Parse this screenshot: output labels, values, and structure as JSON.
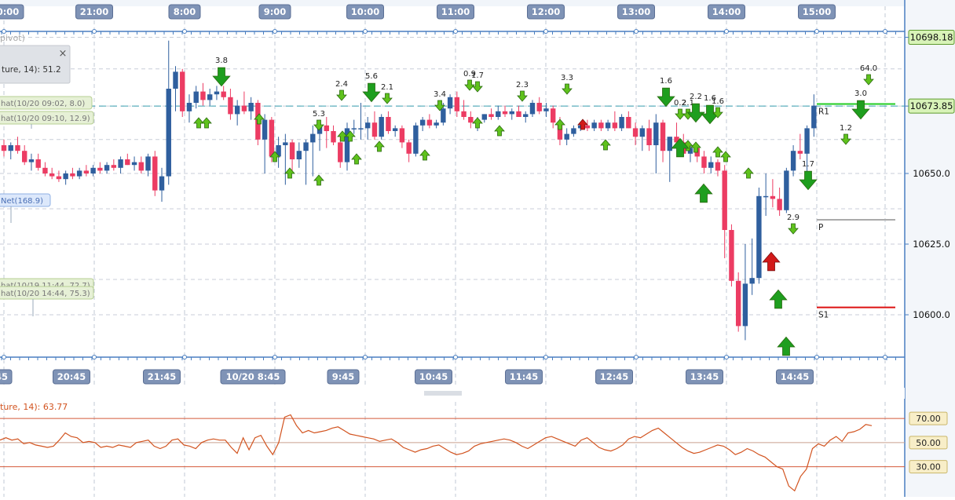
{
  "chart_data": {
    "type": "candlestick",
    "time_axis_top": [
      "0:00",
      "21:00",
      "8:00",
      "9:00",
      "10:00",
      "11:00",
      "12:00",
      "13:00",
      "14:00",
      "15:00"
    ],
    "time_axis_bottom": [
      "45",
      "20:45",
      "21:45",
      "10/20 8:45",
      "9:45",
      "10:45",
      "11:45",
      "12:45",
      "13:45",
      "14:45"
    ],
    "price_axis_labels": [
      "10698.18",
      "10673.85",
      "10650.0",
      "10625.0",
      "10600.0"
    ],
    "ylim": [
      10585,
      10705
    ],
    "current_price_top": 10698.18,
    "current_price": 10673.85,
    "pivot_lines": [
      {
        "label": "R1",
        "value": 10674.6,
        "color": "#22cc22"
      },
      {
        "label": "P",
        "value": 10633.6,
        "color": "#aaaaaa"
      },
      {
        "label": "S1",
        "value": 10602.6,
        "color": "#dd1111"
      }
    ],
    "legend_header": "pivot)",
    "indicator_panel": {
      "text": "ture, 14): 51.2",
      "close_symbol": "×"
    },
    "line_notes": [
      {
        "text": "hat(10/20 09:02, 8.0)"
      },
      {
        "text": "hat(10/20 09:10, 12.9)"
      },
      {
        "text": "Net(168.9)"
      },
      {
        "text": "hat(10/19 11:44, 72.7)"
      },
      {
        "text": "hat(10/20 14:44, 75.3)"
      }
    ],
    "arrow_values": [
      "3.8",
      "5.3",
      "2.4",
      "5.6",
      "2.1",
      "3.4",
      "0.9",
      "1.7",
      "2.3",
      "3.3",
      "1.6",
      "0.2",
      "2.1",
      "2.2",
      "1.6",
      "1.6",
      "2.9",
      "1.7",
      "1.2",
      "3.0",
      "64.0"
    ],
    "candles": [
      [
        10660.0,
        10662.0,
        10656.0,
        10658.0
      ],
      [
        10658.0,
        10661.0,
        10655.0,
        10660.0
      ],
      [
        10660.0,
        10663.0,
        10657.0,
        10658.0
      ],
      [
        10658.0,
        10660.0,
        10653.0,
        10654.0
      ],
      [
        10654.0,
        10657.0,
        10651.0,
        10655.0
      ],
      [
        10655.0,
        10657.0,
        10651.0,
        10652.0
      ],
      [
        10652.0,
        10654.0,
        10649.0,
        10650.0
      ],
      [
        10650.0,
        10652.0,
        10648.0,
        10649.0
      ],
      [
        10649.0,
        10651.0,
        10647.0,
        10648.0
      ],
      [
        10648.0,
        10651.0,
        10646.0,
        10650.0
      ],
      [
        10650.0,
        10652.0,
        10648.0,
        10649.0
      ],
      [
        10649.0,
        10652.0,
        10648.0,
        10651.0
      ],
      [
        10651.0,
        10653.0,
        10649.0,
        10650.0
      ],
      [
        10650.0,
        10653.0,
        10649.0,
        10652.0
      ],
      [
        10652.0,
        10654.0,
        10650.0,
        10651.0
      ],
      [
        10651.0,
        10654.0,
        10650.0,
        10653.0
      ],
      [
        10653.0,
        10655.0,
        10651.0,
        10652.0
      ],
      [
        10652.0,
        10656.0,
        10650.0,
        10655.0
      ],
      [
        10655.0,
        10657.0,
        10653.0,
        10653.0
      ],
      [
        10653.0,
        10656.0,
        10651.0,
        10654.0
      ],
      [
        10654.0,
        10656.0,
        10650.0,
        10651.0
      ],
      [
        10651.0,
        10657.0,
        10649.0,
        10656.0
      ],
      [
        10656.0,
        10658.0,
        10642.0,
        10644.0
      ],
      [
        10644.0,
        10652.0,
        10640.0,
        10649.0
      ],
      [
        10649.0,
        10697.0,
        10646.0,
        10680.0
      ],
      [
        10680.0,
        10688.0,
        10672.0,
        10686.0
      ],
      [
        10686.0,
        10687.0,
        10670.0,
        10672.0
      ],
      [
        10672.0,
        10678.0,
        10668.0,
        10675.0
      ],
      [
        10675.0,
        10681.0,
        10673.0,
        10679.0
      ],
      [
        10679.0,
        10682.0,
        10674.0,
        10676.0
      ],
      [
        10676.0,
        10680.0,
        10674.0,
        10678.0
      ],
      [
        10678.0,
        10681.0,
        10676.0,
        10679.0
      ],
      [
        10679.0,
        10681.0,
        10676.0,
        10677.0
      ],
      [
        10677.0,
        10680.0,
        10669.0,
        10671.0
      ],
      [
        10671.0,
        10676.0,
        10667.0,
        10674.0
      ],
      [
        10674.0,
        10679.0,
        10671.0,
        10672.0
      ],
      [
        10672.0,
        10677.0,
        10669.0,
        10675.0
      ],
      [
        10675.0,
        10676.0,
        10660.0,
        10662.0
      ],
      [
        10662.0,
        10671.0,
        10650.0,
        10669.0
      ],
      [
        10669.0,
        10670.0,
        10654.0,
        10656.0
      ],
      [
        10656.0,
        10663.0,
        10652.0,
        10660.0
      ],
      [
        10660.0,
        10664.0,
        10646.0,
        10661.0
      ],
      [
        10661.0,
        10662.0,
        10651.0,
        10655.0
      ],
      [
        10655.0,
        10661.0,
        10652.0,
        10658.0
      ],
      [
        10658.0,
        10662.0,
        10646.0,
        10661.0
      ],
      [
        10661.0,
        10667.0,
        10649.0,
        10664.0
      ],
      [
        10664.0,
        10669.0,
        10658.0,
        10667.0
      ],
      [
        10667.0,
        10670.0,
        10659.0,
        10665.0
      ],
      [
        10665.0,
        10667.0,
        10660.0,
        10661.0
      ],
      [
        10661.0,
        10664.0,
        10652.0,
        10654.0
      ],
      [
        10654.0,
        10668.0,
        10651.0,
        10666.0
      ],
      [
        10666.0,
        10669.0,
        10664.0,
        10666.0
      ],
      [
        10666.0,
        10675.0,
        10662.0,
        10666.0
      ],
      [
        10666.0,
        10670.0,
        10662.0,
        10668.0
      ],
      [
        10668.0,
        10672.0,
        10662.0,
        10663.0
      ],
      [
        10663.0,
        10671.0,
        10662.0,
        10670.0
      ],
      [
        10670.0,
        10672.0,
        10664.0,
        10665.0
      ],
      [
        10665.0,
        10667.0,
        10663.0,
        10666.0
      ],
      [
        10666.0,
        10667.0,
        10659.0,
        10661.0
      ],
      [
        10661.0,
        10662.0,
        10654.0,
        10657.0
      ],
      [
        10657.0,
        10668.0,
        10656.0,
        10667.0
      ],
      [
        10667.0,
        10670.0,
        10665.0,
        10669.0
      ],
      [
        10669.0,
        10671.0,
        10666.0,
        10667.0
      ],
      [
        10667.0,
        10669.0,
        10666.0,
        10668.0
      ],
      [
        10668.0,
        10675.0,
        10667.0,
        10673.0
      ],
      [
        10673.0,
        10678.0,
        10671.0,
        10677.0
      ],
      [
        10677.0,
        10679.0,
        10670.0,
        10672.0
      ],
      [
        10672.0,
        10676.0,
        10669.0,
        10670.0
      ],
      [
        10670.0,
        10672.0,
        10666.0,
        10668.0
      ],
      [
        10668.0,
        10670.0,
        10665.0,
        10669.0
      ],
      [
        10669.0,
        10671.0,
        10668.0,
        10671.0
      ],
      [
        10671.0,
        10673.0,
        10669.0,
        10670.0
      ],
      [
        10670.0,
        10674.0,
        10669.0,
        10672.0
      ],
      [
        10672.0,
        10674.0,
        10670.0,
        10671.0
      ],
      [
        10671.0,
        10673.0,
        10669.0,
        10672.0
      ],
      [
        10672.0,
        10674.0,
        10670.0,
        10670.0
      ],
      [
        10670.0,
        10672.0,
        10668.0,
        10671.0
      ],
      [
        10671.0,
        10676.0,
        10670.0,
        10675.0
      ],
      [
        10675.0,
        10677.0,
        10671.0,
        10672.0
      ],
      [
        10672.0,
        10675.0,
        10670.0,
        10673.0
      ],
      [
        10673.0,
        10674.0,
        10666.0,
        10668.0
      ],
      [
        10668.0,
        10670.0,
        10660.0,
        10662.0
      ],
      [
        10662.0,
        10666.0,
        10660.0,
        10664.0
      ],
      [
        10664.0,
        10667.0,
        10663.0,
        10666.0
      ],
      [
        10666.0,
        10668.0,
        10665.0,
        10667.0
      ],
      [
        10667.0,
        10669.0,
        10665.0,
        10666.0
      ],
      [
        10666.0,
        10669.0,
        10665.0,
        10668.0
      ],
      [
        10668.0,
        10669.0,
        10665.0,
        10666.0
      ],
      [
        10666.0,
        10669.0,
        10665.0,
        10668.0
      ],
      [
        10668.0,
        10672.0,
        10665.0,
        10666.0
      ],
      [
        10666.0,
        10671.0,
        10665.0,
        10670.0
      ],
      [
        10670.0,
        10672.0,
        10666.0,
        10666.0
      ],
      [
        10666.0,
        10668.0,
        10660.0,
        10663.0
      ],
      [
        10663.0,
        10667.0,
        10658.0,
        10666.0
      ],
      [
        10666.0,
        10669.0,
        10658.0,
        10660.0
      ],
      [
        10660.0,
        10671.0,
        10650.0,
        10668.0
      ],
      [
        10668.0,
        10669.0,
        10654.0,
        10658.0
      ],
      [
        10658.0,
        10663.0,
        10647.0,
        10663.0
      ],
      [
        10663.0,
        10668.0,
        10659.0,
        10661.0
      ],
      [
        10661.0,
        10664.0,
        10656.0,
        10657.0
      ],
      [
        10657.0,
        10660.0,
        10654.0,
        10659.0
      ],
      [
        10659.0,
        10660.0,
        10654.0,
        10656.0
      ],
      [
        10656.0,
        10658.0,
        10650.0,
        10652.0
      ],
      [
        10652.0,
        10656.0,
        10650.0,
        10654.0
      ],
      [
        10654.0,
        10655.0,
        10649.0,
        10651.0
      ],
      [
        10651.0,
        10653.0,
        10620.0,
        10630.0
      ],
      [
        10630.0,
        10632.0,
        10610.0,
        10612.0
      ],
      [
        10612.0,
        10615.0,
        10594.0,
        10596.0
      ],
      [
        10596.0,
        10625.0,
        10591.0,
        10611.0
      ],
      [
        10611.0,
        10627.0,
        10607.0,
        10613.0
      ],
      [
        10613.0,
        10645.0,
        10611.0,
        10642.0
      ],
      [
        10642.0,
        10650.0,
        10635.0,
        10642.0
      ],
      [
        10642.0,
        10648.0,
        10638.0,
        10641.0
      ],
      [
        10641.0,
        10645.0,
        10635.0,
        10637.0
      ],
      [
        10637.0,
        10652.0,
        10636.0,
        10651.0
      ],
      [
        10651.0,
        10660.0,
        10649.0,
        10658.0
      ],
      [
        10658.0,
        10664.0,
        10655.0,
        10657.0
      ],
      [
        10657.0,
        10667.0,
        10649.0,
        10666.0
      ],
      [
        10666.0,
        10678.0,
        10663.0,
        10674.0
      ]
    ],
    "sub_chart": {
      "label": "ture, 14): 63.77",
      "levels": [
        "70.00",
        "50.00",
        "30.00"
      ],
      "ylim": [
        5,
        85
      ],
      "values": [
        52,
        54,
        52,
        53,
        49,
        50,
        48,
        47,
        46,
        47,
        52,
        58,
        55,
        54,
        50,
        51,
        50,
        46,
        47,
        46,
        48,
        47,
        46,
        50,
        51,
        52,
        47,
        45,
        47,
        52,
        53,
        48,
        47,
        45,
        50,
        52,
        53,
        52,
        52,
        46,
        41,
        54,
        44,
        54,
        56,
        47,
        40,
        50,
        71,
        73,
        64,
        58,
        60,
        58,
        59,
        60,
        62,
        63,
        60,
        57,
        56,
        55,
        54,
        53,
        51,
        52,
        53,
        50,
        46,
        44,
        42,
        44,
        45,
        47,
        48,
        45,
        42,
        40,
        41,
        43,
        47,
        49,
        50,
        51,
        52,
        53,
        52,
        50,
        47,
        45,
        48,
        51,
        54,
        55,
        53,
        51,
        49,
        47,
        52,
        54,
        50,
        46,
        44,
        43,
        45,
        48,
        53,
        55,
        54,
        57,
        60,
        62,
        58,
        54,
        50,
        46,
        43,
        41,
        42,
        44,
        46,
        48,
        47,
        44,
        40,
        42,
        45,
        43,
        40,
        38,
        34,
        30,
        28,
        14,
        10,
        22,
        28,
        45,
        49,
        47,
        52,
        55,
        51,
        58,
        59,
        61,
        65,
        64
      ]
    }
  }
}
